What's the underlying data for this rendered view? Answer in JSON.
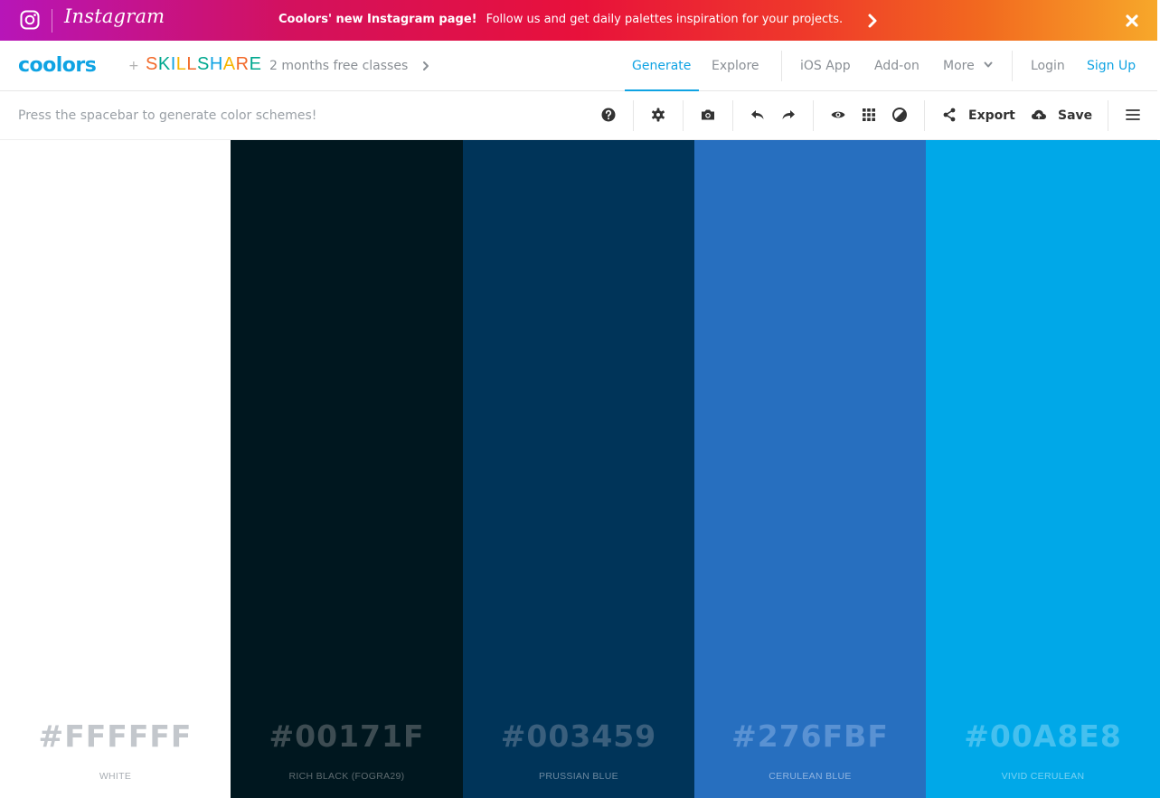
{
  "banner": {
    "brand": "Instagram",
    "headline": "Coolors' new Instagram page!",
    "message": "Follow us and get daily palettes inspiration for your projects."
  },
  "nav": {
    "logo": "coolors",
    "plus": "+",
    "partner": "SKILLSHARE",
    "promo": "2 months free classes",
    "items": {
      "generate": "Generate",
      "explore": "Explore",
      "ios": "iOS App",
      "addon": "Add-on",
      "more": "More",
      "login": "Login",
      "signup": "Sign Up"
    }
  },
  "toolbar": {
    "hint": "Press the spacebar to generate color schemes!",
    "export": "Export",
    "save": "Save",
    "icons": [
      "help-icon",
      "gear-icon",
      "camera-icon",
      "undo-icon",
      "redo-icon",
      "eye-icon",
      "grid-icon",
      "contrast-icon",
      "share-icon",
      "cloud-upload-icon",
      "menu-icon"
    ]
  },
  "palette": [
    {
      "hex": "#FFFFFF",
      "name": "WHITE",
      "bg": "#ffffff",
      "hex_color": "#c3c7cc",
      "name_color": "#a8adb3"
    },
    {
      "hex": "#00171F",
      "name": "RICH BLACK (FOGRA29)",
      "bg": "#00171f",
      "hex_color": "#3d4c52",
      "name_color": "#5e6b70"
    },
    {
      "hex": "#003459",
      "name": "PRUSSIAN BLUE",
      "bg": "#003459",
      "hex_color": "#3a5f7d",
      "name_color": "#6c89a0"
    },
    {
      "hex": "#276FBF",
      "name": "CERULEAN BLUE",
      "bg": "#276fbf",
      "hex_color": "#5a92d3",
      "name_color": "#8fb4e0"
    },
    {
      "hex": "#00A8E8",
      "name": "VIVID CERULEAN",
      "bg": "#00a8e8",
      "hex_color": "#45c0ef",
      "name_color": "#7ad2f3"
    }
  ],
  "colors": {
    "accent": "#0fa3e3"
  }
}
